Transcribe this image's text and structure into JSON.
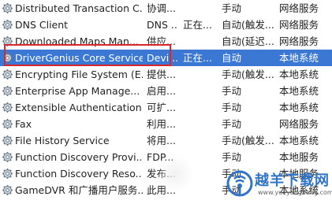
{
  "services": [
    {
      "name": "Distributed Transaction C...",
      "description": "协调...",
      "status": "",
      "startup": "手动",
      "logon": "网络服务",
      "selected": false
    },
    {
      "name": "DNS Client",
      "description": "DNS ...",
      "status": "正在...",
      "startup": "自动(触发...",
      "logon": "网络服务",
      "selected": false
    },
    {
      "name": "Downloaded Maps Man...",
      "description": "供应...",
      "status": "",
      "startup": "自动(延迟...",
      "logon": "网络服务",
      "selected": false
    },
    {
      "name": "DriverGenius Core Service",
      "description": "Devi...",
      "status": "正在...",
      "startup": "自动",
      "logon": "本地系统",
      "selected": true
    },
    {
      "name": "Encrypting File System (E...",
      "description": "提供...",
      "status": "",
      "startup": "手动(触发...",
      "logon": "本地系统",
      "selected": false
    },
    {
      "name": "Enterprise App Manage...",
      "description": "启用...",
      "status": "",
      "startup": "手动",
      "logon": "本地系统",
      "selected": false
    },
    {
      "name": "Extensible Authentication...",
      "description": "可扩...",
      "status": "",
      "startup": "手动",
      "logon": "本地系统",
      "selected": false
    },
    {
      "name": "Fax",
      "description": "利用...",
      "status": "",
      "startup": "手动",
      "logon": "网络服务",
      "selected": false
    },
    {
      "name": "File History Service",
      "description": "将用...",
      "status": "",
      "startup": "手动(触发...",
      "logon": "本地系统",
      "selected": false
    },
    {
      "name": "Function Discovery Provi...",
      "description": "FDP...",
      "status": "",
      "startup": "手动",
      "logon": "本地服务",
      "selected": false
    },
    {
      "name": "Function Discovery Reso...",
      "description": "发布...",
      "status": "",
      "startup": "手动",
      "logon": "本地服务",
      "selected": false
    },
    {
      "name": "GameDVR 和广播用户服务...",
      "description": "此用...",
      "status": "",
      "startup": "手动",
      "logon": "本地系统",
      "selected": false
    }
  ],
  "watermark": {
    "title": "越羊下载网",
    "url": "www.yueyangbang.com",
    "accent": "#2f74c9"
  },
  "colors": {
    "selection": "#3b78d4",
    "highlight_box": "#d9262a"
  }
}
